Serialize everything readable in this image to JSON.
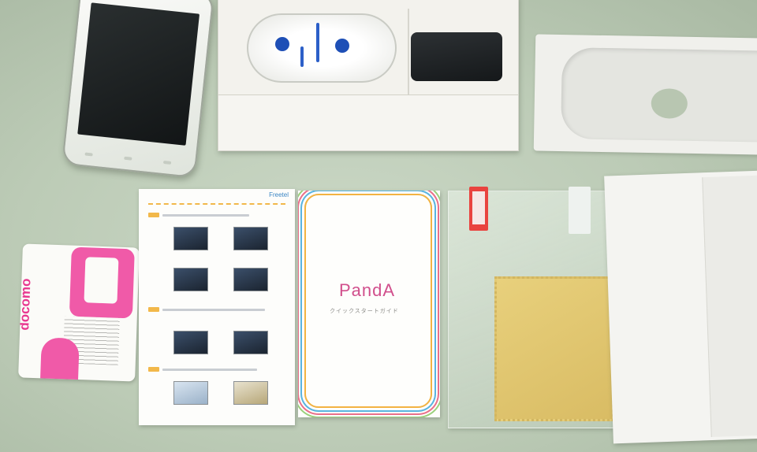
{
  "scene": {
    "sim_card": {
      "logo_text": "docomo"
    },
    "leaflet": {
      "brand_text": "Freetel"
    },
    "quick_start_guide": {
      "title": "PandA",
      "subtitle": "クイックスタートガイド"
    },
    "colors": {
      "table": "#bccbb6",
      "docomo_pink": "#f05aa8",
      "earphone_blue": "#1e4fb6",
      "protector_tag_red": "#e9433f",
      "cleaning_cloth": "#e0c470"
    }
  }
}
